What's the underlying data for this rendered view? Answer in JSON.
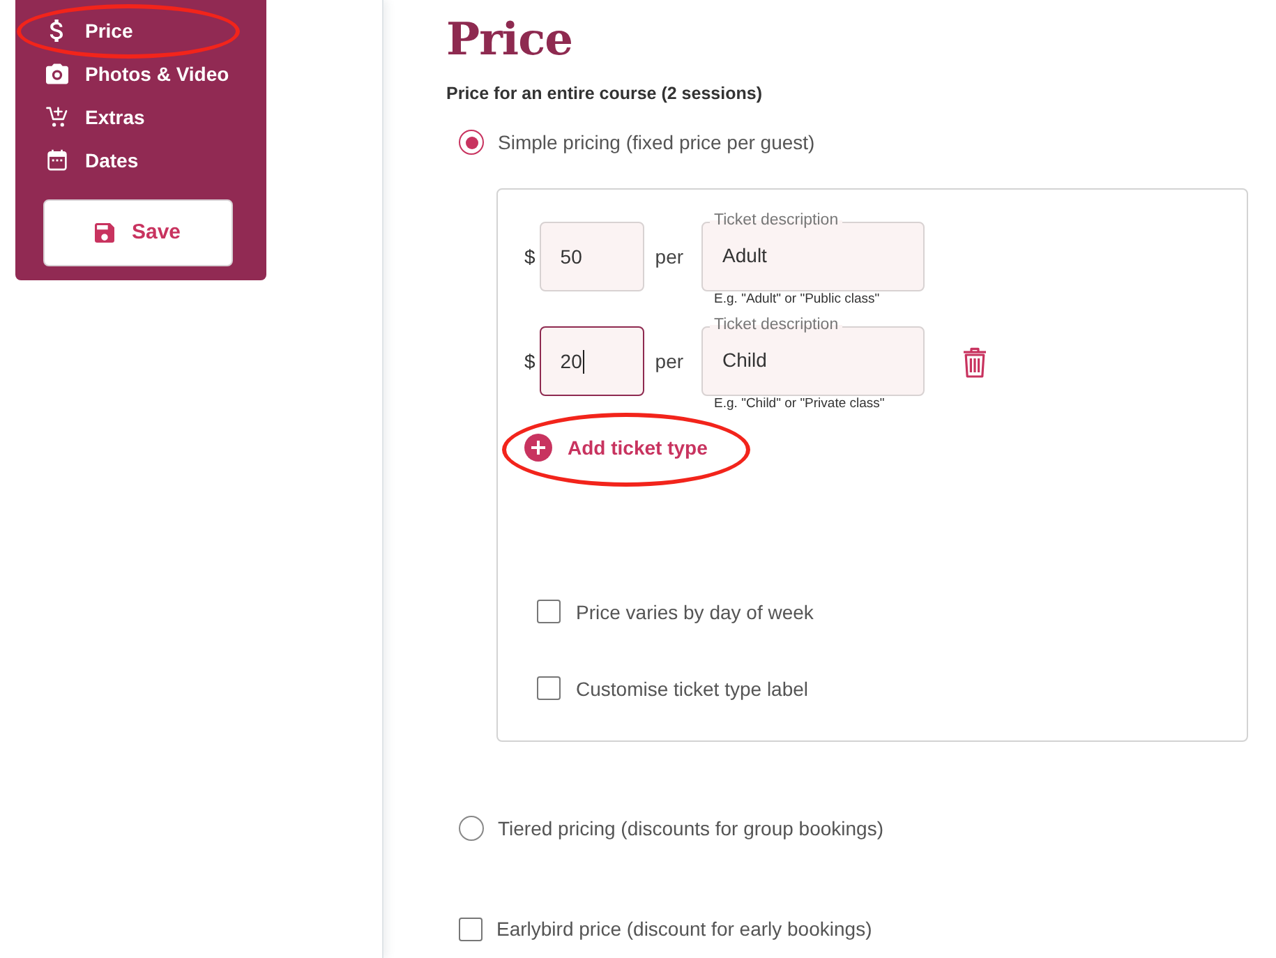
{
  "sidebar": {
    "items": [
      {
        "label": "Price",
        "highlighted": true
      },
      {
        "label": "Photos & Video",
        "highlighted": false
      },
      {
        "label": "Extras",
        "highlighted": false
      },
      {
        "label": "Dates",
        "highlighted": false
      }
    ],
    "save_button": {
      "label": "Save"
    }
  },
  "page": {
    "title": "Price",
    "subtitle": "Price for an entire course (2 sessions)"
  },
  "pricing_options": [
    {
      "kind": "radio",
      "label": "Simple pricing (fixed price per guest)",
      "selected": true,
      "panel": {
        "tickets": [
          {
            "currency": "$",
            "price": "50",
            "per": "per",
            "description_label": "Ticket description",
            "description": "Adult",
            "hint": "E.g. \"Adult\" or \"Public class\"",
            "focused": false,
            "removable": false
          },
          {
            "currency": "$",
            "price": "20",
            "per": "per",
            "description_label": "Ticket description",
            "description": "Child",
            "hint": "E.g. \"Child\" or \"Private class\"",
            "focused": true,
            "removable": true
          }
        ],
        "add_ticket_button": {
          "label": "Add ticket type",
          "highlighted": true
        },
        "options": [
          {
            "label": "Price varies by day of week",
            "checked": false
          },
          {
            "label": "Customise ticket type label",
            "checked": false
          }
        ]
      }
    },
    {
      "kind": "radio",
      "label": "Tiered pricing (discounts for group bookings)",
      "selected": false
    },
    {
      "kind": "checkbox",
      "label": "Earlybird price (discount for early bookings)",
      "checked": false
    }
  ]
}
